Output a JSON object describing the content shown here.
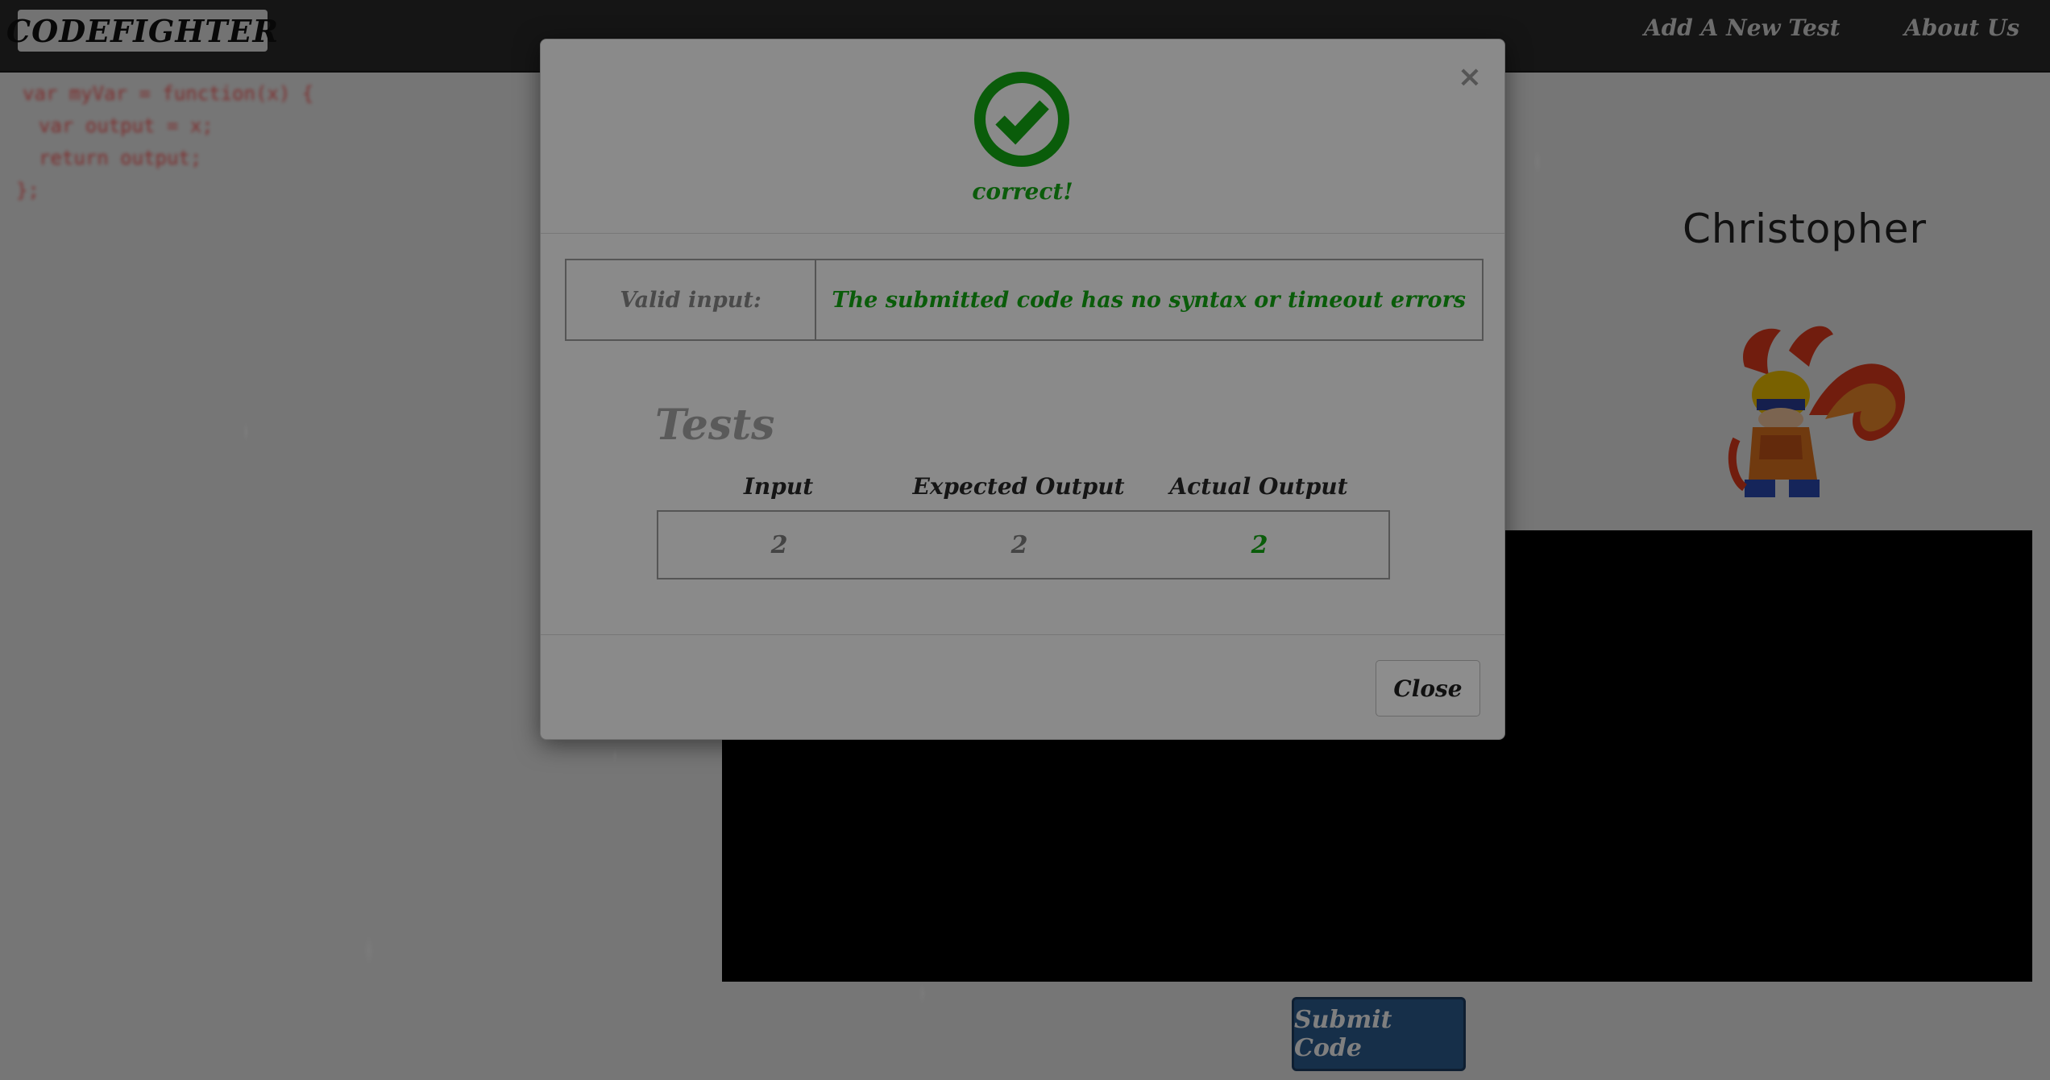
{
  "navbar": {
    "brand": "CODEFIGHTER",
    "links": [
      "Add A New Test",
      "About Us"
    ]
  },
  "editor": {
    "lines": [
      "var myVar = function(x) {",
      "var output = x;",
      "return output;",
      "};"
    ]
  },
  "player": {
    "name": "Christopher"
  },
  "actions": {
    "submit_label": "Submit Code"
  },
  "modal": {
    "close_symbol": "×",
    "status": "correct!",
    "validity": {
      "label": "Valid input:",
      "message": "The submitted code has no syntax or timeout errors"
    },
    "tests": {
      "heading": "Tests",
      "columns": [
        "Input",
        "Expected Output",
        "Actual Output"
      ],
      "rows": [
        {
          "input": "2",
          "expected": "2",
          "actual": "2"
        }
      ]
    },
    "close_label": "Close"
  },
  "colors": {
    "success": "#0a5c0a",
    "submit_button": "#2d5f93",
    "navbar": "#2b2b2b"
  },
  "icons": {
    "status": "check-circle-icon",
    "close": "close-icon"
  }
}
